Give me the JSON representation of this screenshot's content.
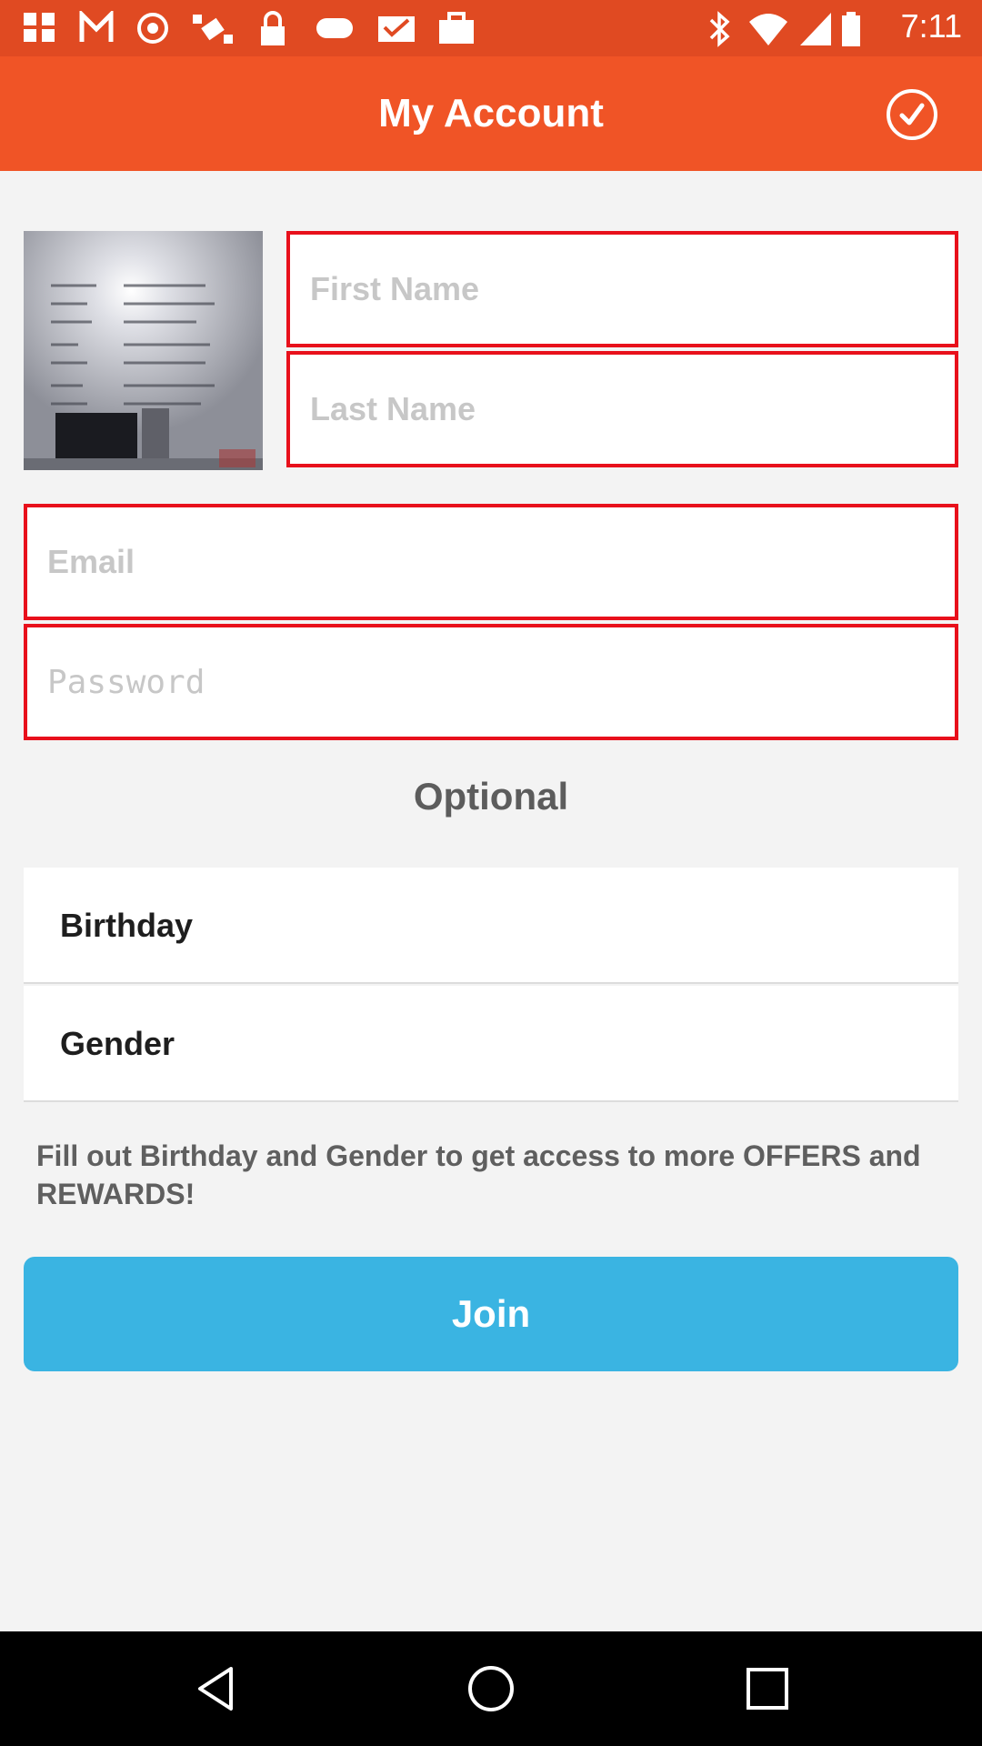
{
  "status_bar": {
    "time": "7:11",
    "icons": [
      "fake-gps-icon",
      "signal-icon",
      "clock-icon",
      "satellite-icon",
      "lock-icon",
      "game-controller-icon",
      "inbox-icon",
      "bag-icon",
      "bluetooth-icon",
      "wifi-icon",
      "cell-signal-icon",
      "battery-icon"
    ]
  },
  "header": {
    "title": "My Account",
    "confirm_icon": "check-circle-icon"
  },
  "form": {
    "first_name": {
      "placeholder": "First Name",
      "value": ""
    },
    "last_name": {
      "placeholder": "Last Name",
      "value": ""
    },
    "email": {
      "placeholder": "Email",
      "value": ""
    },
    "password": {
      "placeholder": "Password",
      "value": ""
    }
  },
  "optional": {
    "heading": "Optional",
    "birthday_label": "Birthday",
    "gender_label": "Gender",
    "info_text": "Fill out Birthday and Gender to get access to more OFFERS and REWARDS!"
  },
  "join_label": "Join",
  "colors": {
    "status_bar": "#e04a22",
    "app_bar": "#f05426",
    "field_border": "#e8101b",
    "join_button": "#3ab4e2",
    "background": "#f3f3f3"
  },
  "nav_bar": {
    "icons": [
      "back-icon",
      "home-icon",
      "recents-icon"
    ]
  }
}
